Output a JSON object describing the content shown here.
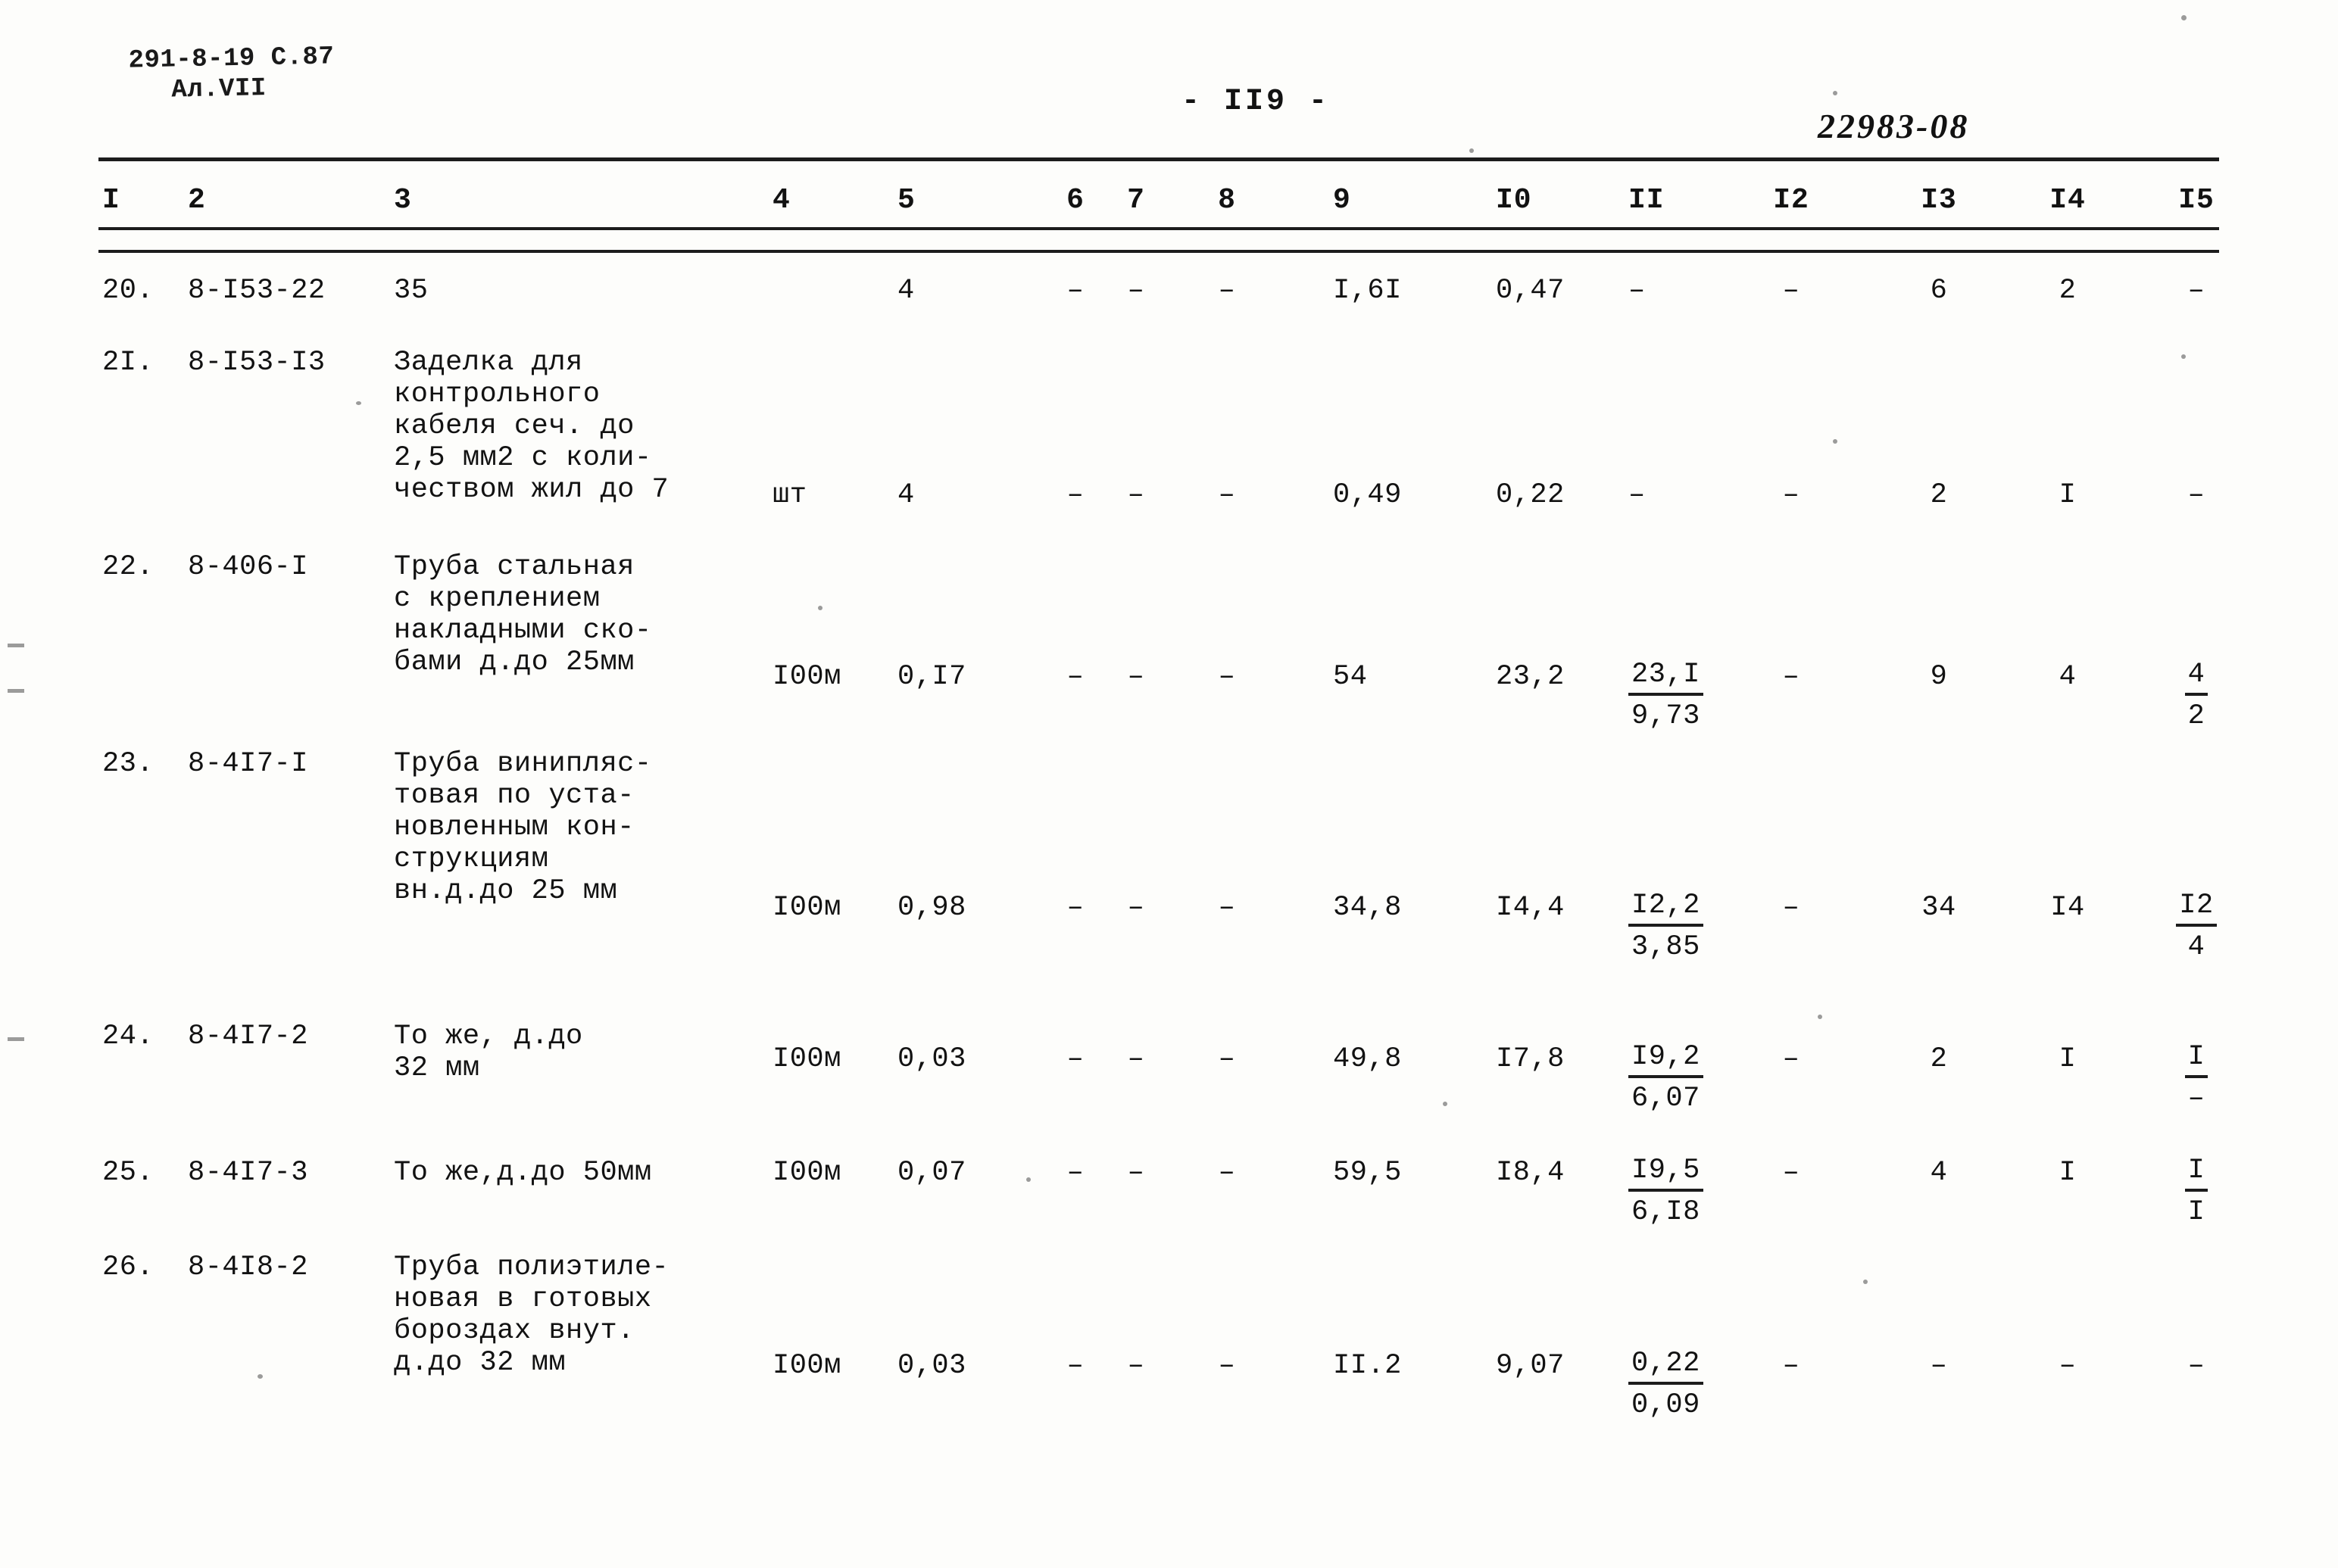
{
  "header": {
    "stamp_line1": "291-8-19 С.87",
    "stamp_line2": "Ал.VII",
    "page_number": "- II9 -",
    "doc_code": "22983-08"
  },
  "table": {
    "column_headers": [
      "I",
      "2",
      "3",
      "4",
      "5",
      "6",
      "7",
      "8",
      "9",
      "I0",
      "II",
      "I2",
      "I3",
      "I4",
      "I5"
    ],
    "rows": [
      {
        "num": "20.",
        "code": "8-I53-22",
        "desc": [
          "35"
        ],
        "unit": "",
        "c5": "4",
        "c6": "–",
        "c7": "–",
        "c8": "–",
        "c9": "I,6I",
        "c10": "0,47",
        "c11": "–",
        "c11b": "",
        "c12": "–",
        "c13": "6",
        "c14": "2",
        "c15": "–",
        "c15b": ""
      },
      {
        "num": "2I.",
        "code": "8-I53-I3",
        "desc": [
          "Заделка для",
          "контрольного",
          "кабеля сеч. до",
          "2,5 мм2 с коли-",
          "чеством жил до 7"
        ],
        "unit": "шт",
        "c5": "4",
        "c6": "–",
        "c7": "–",
        "c8": "–",
        "c9": "0,49",
        "c10": "0,22",
        "c11": "–",
        "c11b": "",
        "c12": "–",
        "c13": "2",
        "c14": "I",
        "c15": "–",
        "c15b": ""
      },
      {
        "num": "22.",
        "code": "8-406-I",
        "desc": [
          "Труба стальная",
          "с креплением",
          "накладными ско-",
          "бами д.до 25мм"
        ],
        "unit": "I00м",
        "c5": "0,I7",
        "c6": "–",
        "c7": "–",
        "c8": "–",
        "c9": "54",
        "c10": "23,2",
        "c11": "23,I",
        "c11b": "9,73",
        "c12": "–",
        "c13": "9",
        "c14": "4",
        "c15": "4",
        "c15b": "2"
      },
      {
        "num": "23.",
        "code": "8-4I7-I",
        "desc": [
          "Труба винипляс-",
          "товая по уста-",
          "новленным кон-",
          "струкциям",
          "вн.д.до 25 мм"
        ],
        "unit": "I00м",
        "c5": "0,98",
        "c6": "–",
        "c7": "–",
        "c8": "–",
        "c9": "34,8",
        "c10": "I4,4",
        "c11": "I2,2",
        "c11b": "3,85",
        "c12": "–",
        "c13": "34",
        "c14": "I4",
        "c15": "I2",
        "c15b": "4"
      },
      {
        "num": "24.",
        "code": "8-4I7-2",
        "desc": [
          "То же, д.до",
          "32 мм"
        ],
        "unit": "I00м",
        "c5": "0,03",
        "c6": "–",
        "c7": "–",
        "c8": "–",
        "c9": "49,8",
        "c10": "I7,8",
        "c11": "I9,2",
        "c11b": "6,07",
        "c12": "–",
        "c13": "2",
        "c14": "I",
        "c15": "I",
        "c15b": "–"
      },
      {
        "num": "25.",
        "code": "8-4I7-3",
        "desc": [
          "То же,д.до 50мм"
        ],
        "unit": "I00м",
        "c5": "0,07",
        "c6": "–",
        "c7": "–",
        "c8": "–",
        "c9": "59,5",
        "c10": "I8,4",
        "c11": "I9,5",
        "c11b": "6,I8",
        "c12": "–",
        "c13": "4",
        "c14": "I",
        "c15": "I",
        "c15b": "I"
      },
      {
        "num": "26.",
        "code": "8-4I8-2",
        "desc": [
          "Труба полиэтиле-",
          "новая в готовых",
          "бороздах внут.",
          "д.до 32 мм"
        ],
        "unit": "I00м",
        "c5": "0,03",
        "c6": "–",
        "c7": "–",
        "c8": "–",
        "c9": "II.2",
        "c10": "9,07",
        "c11": "0,22",
        "c11b": "0,09",
        "c12": "–",
        "c13": "–",
        "c14": "–",
        "c15": "–",
        "c15b": ""
      }
    ]
  }
}
